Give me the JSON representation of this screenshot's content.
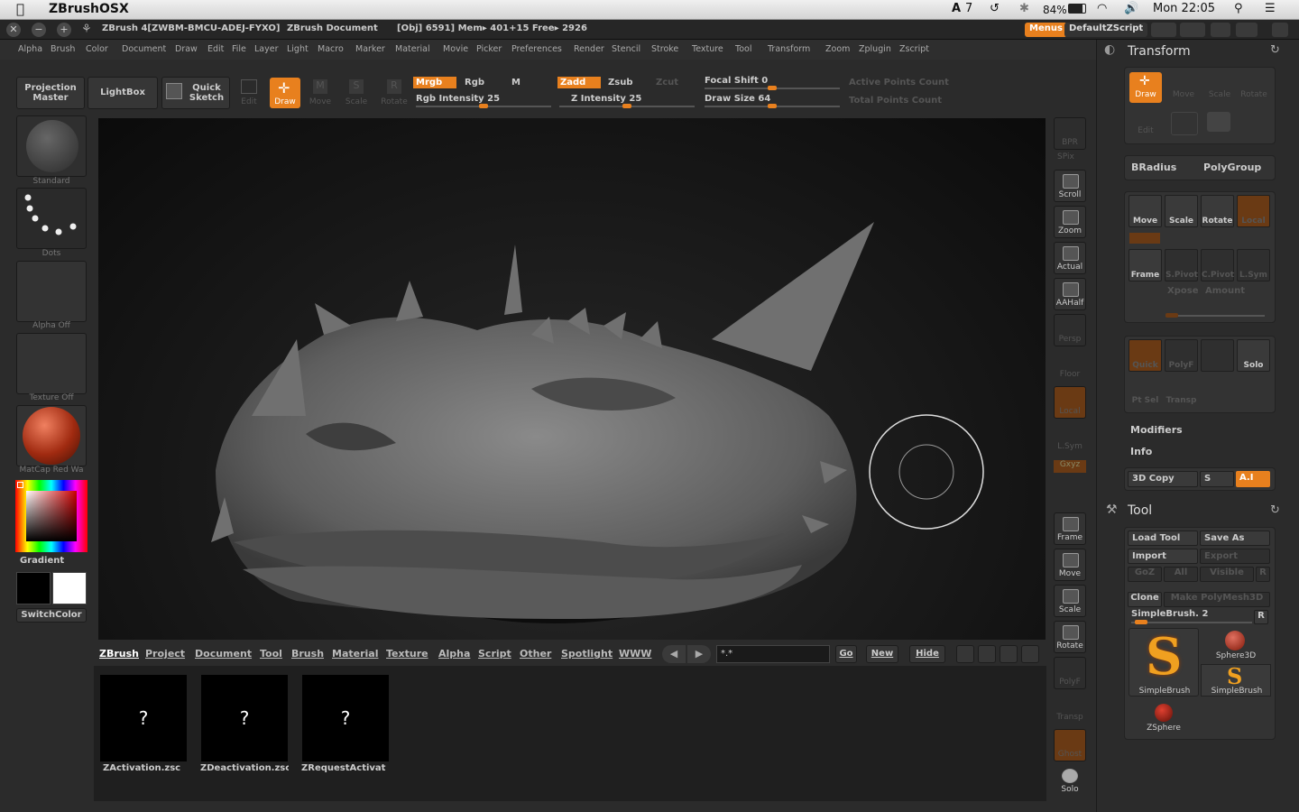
{
  "mac": {
    "app_name": "ZBrushOSX",
    "adobe_count": "7",
    "battery": "84%",
    "clock": "Mon 22:05"
  },
  "title": {
    "app": "ZBrush 4[ZWBM-BMCU-ADEJ-FYXO]",
    "doc": "ZBrush Document",
    "stats": "[Obj] 6591]  Mem▸ 401+15  Free▸ 2926",
    "menus_btn": "Menus",
    "script_btn": "DefaultZScript"
  },
  "menubar": [
    "Alpha",
    "Brush",
    "Color",
    "Document",
    "Draw",
    "Edit",
    "File",
    "Layer",
    "Light",
    "Macro",
    "Marker",
    "Material",
    "Movie",
    "Picker",
    "Preferences",
    "Render",
    "Stencil",
    "Stroke",
    "Texture",
    "Tool",
    "Transform",
    "Zoom",
    "Zplugin",
    "Zscript"
  ],
  "shelf": {
    "projection_master": "Projection Master",
    "lightbox": "LightBox",
    "quick_sketch": "Quick Sketch",
    "edit": "Edit",
    "draw": "Draw",
    "move": "Move",
    "scale": "Scale",
    "rotate": "Rotate",
    "mrgb": "Mrgb",
    "rgb": "Rgb",
    "m": "M",
    "rgb_intensity": "Rgb Intensity 25",
    "zadd": "Zadd",
    "zsub": "Zsub",
    "zcut": "Zcut",
    "z_intensity": "Z Intensity 25",
    "focal_shift": "Focal Shift 0",
    "draw_size": "Draw Size 64",
    "active_points": "Active Points Count",
    "total_points": "Total Points Count"
  },
  "left_tray": {
    "brush": "Standard",
    "stroke": "Dots",
    "alpha": "Alpha  Off",
    "texture": "Texture  Off",
    "material": "MatCap  Red  Wa",
    "gradient": "Gradient",
    "switchcolor": "SwitchColor"
  },
  "right_tray": [
    "BPR",
    "SPix",
    "Scroll",
    "Zoom",
    "Actual",
    "AAHalf",
    "Persp",
    "Floor",
    "Local",
    "L.Sym",
    "Gxyz",
    "Frame",
    "Move",
    "Scale",
    "Rotate",
    "PolyF",
    "Transp",
    "Ghost",
    "Solo"
  ],
  "lightbox": {
    "tabs": [
      "ZBrush",
      "Project",
      "Document",
      "Tool",
      "Brush",
      "Material",
      "Texture",
      "Alpha",
      "Script",
      "Other",
      "Spotlight",
      "WWW"
    ],
    "search": "*.*",
    "go": "Go",
    "new": "New",
    "hide": "Hide",
    "items": [
      {
        "q": "?",
        "name": "ZActivation.zsc"
      },
      {
        "q": "?",
        "name": "ZDeactivation.zsc"
      },
      {
        "q": "?",
        "name": "ZRequestActivat"
      }
    ]
  },
  "transform": {
    "title": "Transform",
    "row1": [
      "Draw",
      "Move",
      "Scale",
      "Rotate"
    ],
    "row2": [
      "Edit"
    ],
    "bradius": "BRadius",
    "polygroup": "PolyGroup",
    "nav": [
      "Move",
      "Scale",
      "Rotate",
      "Local"
    ],
    "frame_row": [
      "Frame",
      "S.Pivot",
      "C.Pivot",
      "L.Sym"
    ],
    "xpose": "Xpose",
    "amount": "Amount",
    "polyf_row": [
      "Quick",
      "PolyF",
      "",
      "Solo"
    ],
    "ptsel": "Pt Sel",
    "transp": "Transp",
    "modifiers": "Modifiers",
    "info": "Info",
    "copy3d": "3D Copy",
    "s": "S",
    "ai": "A.I"
  },
  "tool": {
    "title": "Tool",
    "load": "Load Tool",
    "saveas": "Save As",
    "import": "Import",
    "export": "Export",
    "goz": "GoZ",
    "all": "All",
    "visible": "Visible",
    "r": "R",
    "clone": "Clone",
    "make_polymesh": "Make PolyMesh3D",
    "current": "SimpleBrush. 2",
    "r2": "R",
    "items": [
      "SimpleBrush",
      "Sphere3D",
      "SimpleBrush",
      "ZSphere"
    ]
  },
  "colors": {
    "accent": "#e8801e",
    "bg": "#2b2b2b",
    "canvas": "#0b0b0b",
    "model": "#6b6b6b"
  }
}
